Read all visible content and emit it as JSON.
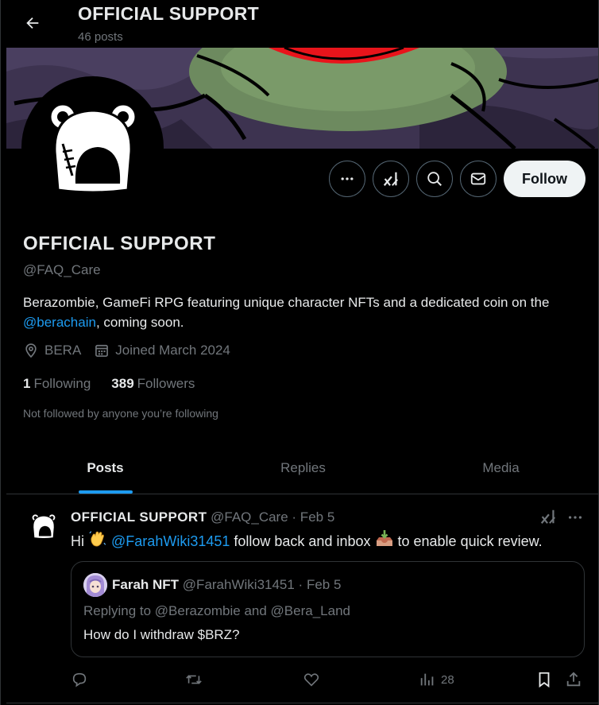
{
  "header": {
    "back_icon": "arrow-left-icon",
    "title": "OFFICIAL SUPPORT",
    "post_count": "46 posts"
  },
  "profile": {
    "name": "OFFICIAL SUPPORT",
    "handle": "@FAQ_Care",
    "bio_prefix": "Berazombie, GameFi RPG featuring unique character NFTs and a dedicated coin on the ",
    "bio_link": "@berachain",
    "bio_suffix": ", coming soon.",
    "location": "BERA",
    "joined": "Joined March 2024",
    "following_count": "1",
    "following_label": "Following",
    "followers_count": "389",
    "followers_label": "Followers",
    "followed_by": "Not followed by anyone you’re following"
  },
  "actions": {
    "more_icon": "more-icon",
    "grok_icon": "grok-icon",
    "search_icon": "search-icon",
    "message_icon": "envelope-icon",
    "follow_label": "Follow"
  },
  "tabs": [
    {
      "label": "Posts",
      "active": true
    },
    {
      "label": "Replies",
      "active": false
    },
    {
      "label": "Media",
      "active": false
    }
  ],
  "post": {
    "author_name": "OFFICIAL SUPPORT",
    "author_handle": "@FAQ_Care",
    "date": "· Feb 5",
    "text_prefix": "Hi",
    "mention": "@FarahWiki31451",
    "text_middle": " follow back and inbox",
    "text_suffix": " to enable quick review.",
    "quote": {
      "author_name": "Farah NFT",
      "author_handle": "@FarahWiki31451 · Feb 5",
      "replying": "Replying to @Berazombie and @Bera_Land",
      "text": "How do I withdraw $BRZ?"
    },
    "views": "28"
  },
  "colors": {
    "background": "#000000",
    "accent": "#1d9bf0",
    "text_primary": "#e7e9ea",
    "text_secondary": "#71767b",
    "border": "#2f3336",
    "banner_purple": "#3d3350",
    "banner_red": "#e8141b"
  }
}
